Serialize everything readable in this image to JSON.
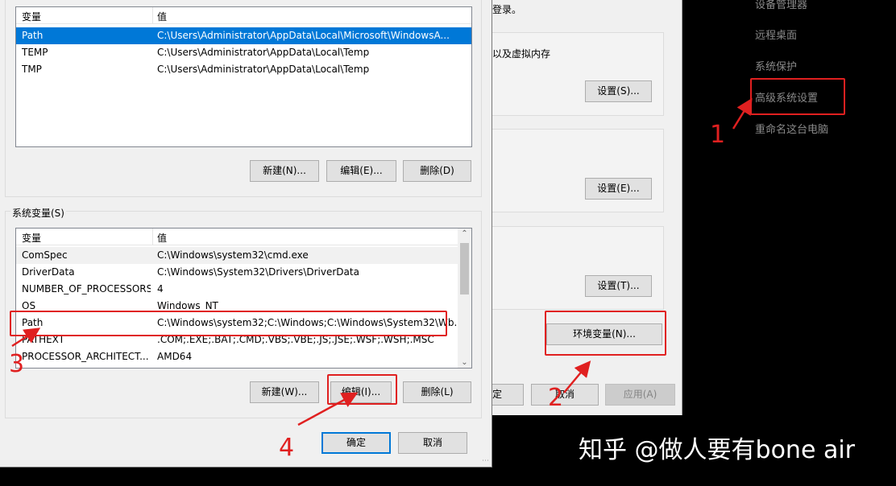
{
  "settings_sidebar": {
    "items": [
      "设备管理器",
      "远程桌面",
      "系统保护",
      "高级系统设置",
      "重命名这台电脑"
    ]
  },
  "system_properties": {
    "text_login": "登录。",
    "text_virtual_memory": "以及虚拟内存",
    "settings_button_1": "设置(S)...",
    "settings_button_2": "设置(E)...",
    "settings_button_3": "设置(T)...",
    "env_vars_button": "环境变量(N)...",
    "ok_label": "定",
    "cancel_label": "取消",
    "apply_label": "应用(A)"
  },
  "env_dialog": {
    "user_vars": {
      "col_var": "变量",
      "col_val": "值",
      "rows": [
        {
          "name": "Path",
          "value": "C:\\Users\\Administrator\\AppData\\Local\\Microsoft\\WindowsA...",
          "selected": true
        },
        {
          "name": "TEMP",
          "value": "C:\\Users\\Administrator\\AppData\\Local\\Temp",
          "selected": false
        },
        {
          "name": "TMP",
          "value": "C:\\Users\\Administrator\\AppData\\Local\\Temp",
          "selected": false
        }
      ],
      "new_button": "新建(N)...",
      "edit_button": "编辑(E)...",
      "delete_button": "删除(D)"
    },
    "system_vars": {
      "group_label": "系统变量(S)",
      "col_var": "变量",
      "col_val": "值",
      "rows": [
        {
          "name": "ComSpec",
          "value": "C:\\Windows\\system32\\cmd.exe"
        },
        {
          "name": "DriverData",
          "value": "C:\\Windows\\System32\\Drivers\\DriverData"
        },
        {
          "name": "NUMBER_OF_PROCESSORS",
          "value": "4"
        },
        {
          "name": "OS",
          "value": "Windows_NT"
        },
        {
          "name": "Path",
          "value": "C:\\Windows\\system32;C:\\Windows;C:\\Windows\\System32\\Wb..."
        },
        {
          "name": "PATHEXT",
          "value": ".COM;.EXE;.BAT;.CMD;.VBS;.VBE;.JS;.JSE;.WSF;.WSH;.MSC"
        },
        {
          "name": "PROCESSOR_ARCHITECT...",
          "value": "AMD64"
        }
      ],
      "new_button": "新建(W)...",
      "edit_button": "编辑(I)...",
      "delete_button": "删除(L)"
    },
    "ok_button": "确定",
    "cancel_button": "取消"
  },
  "annotations": {
    "step1": "1",
    "step2": "2",
    "step3": "3",
    "step4": "4",
    "color": "#e02020"
  },
  "watermark": "知乎 @做人要有bone air"
}
